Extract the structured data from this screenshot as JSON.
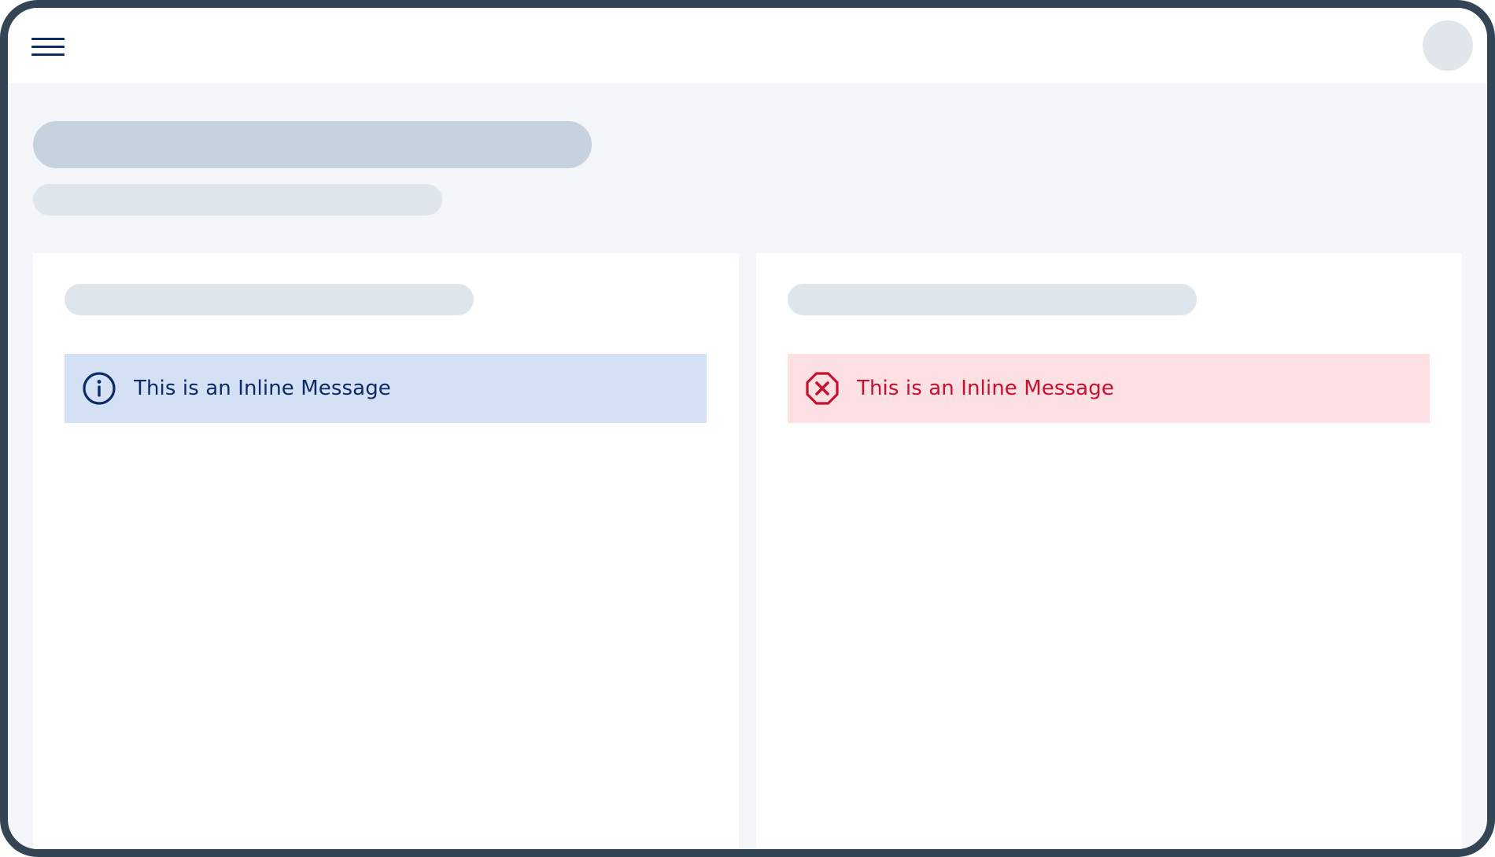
{
  "colors": {
    "frame": "#334455",
    "page_background": "#f4f6f9",
    "brand_navy": "#0b2a66",
    "info_background": "#d4e1f5",
    "error_background": "#fde0e3",
    "error_red": "#c8102e",
    "skeleton_dark": "#c6d2de",
    "skeleton_light": "#dfe5ed"
  },
  "header": {
    "menu_icon": "hamburger-menu-icon",
    "avatar": "avatar-placeholder"
  },
  "cards": [
    {
      "message": {
        "variant": "info",
        "icon": "info-circle-icon",
        "text": "This is an Inline Message"
      }
    },
    {
      "message": {
        "variant": "error",
        "icon": "error-octagon-icon",
        "text": "This is an Inline Message"
      }
    }
  ]
}
